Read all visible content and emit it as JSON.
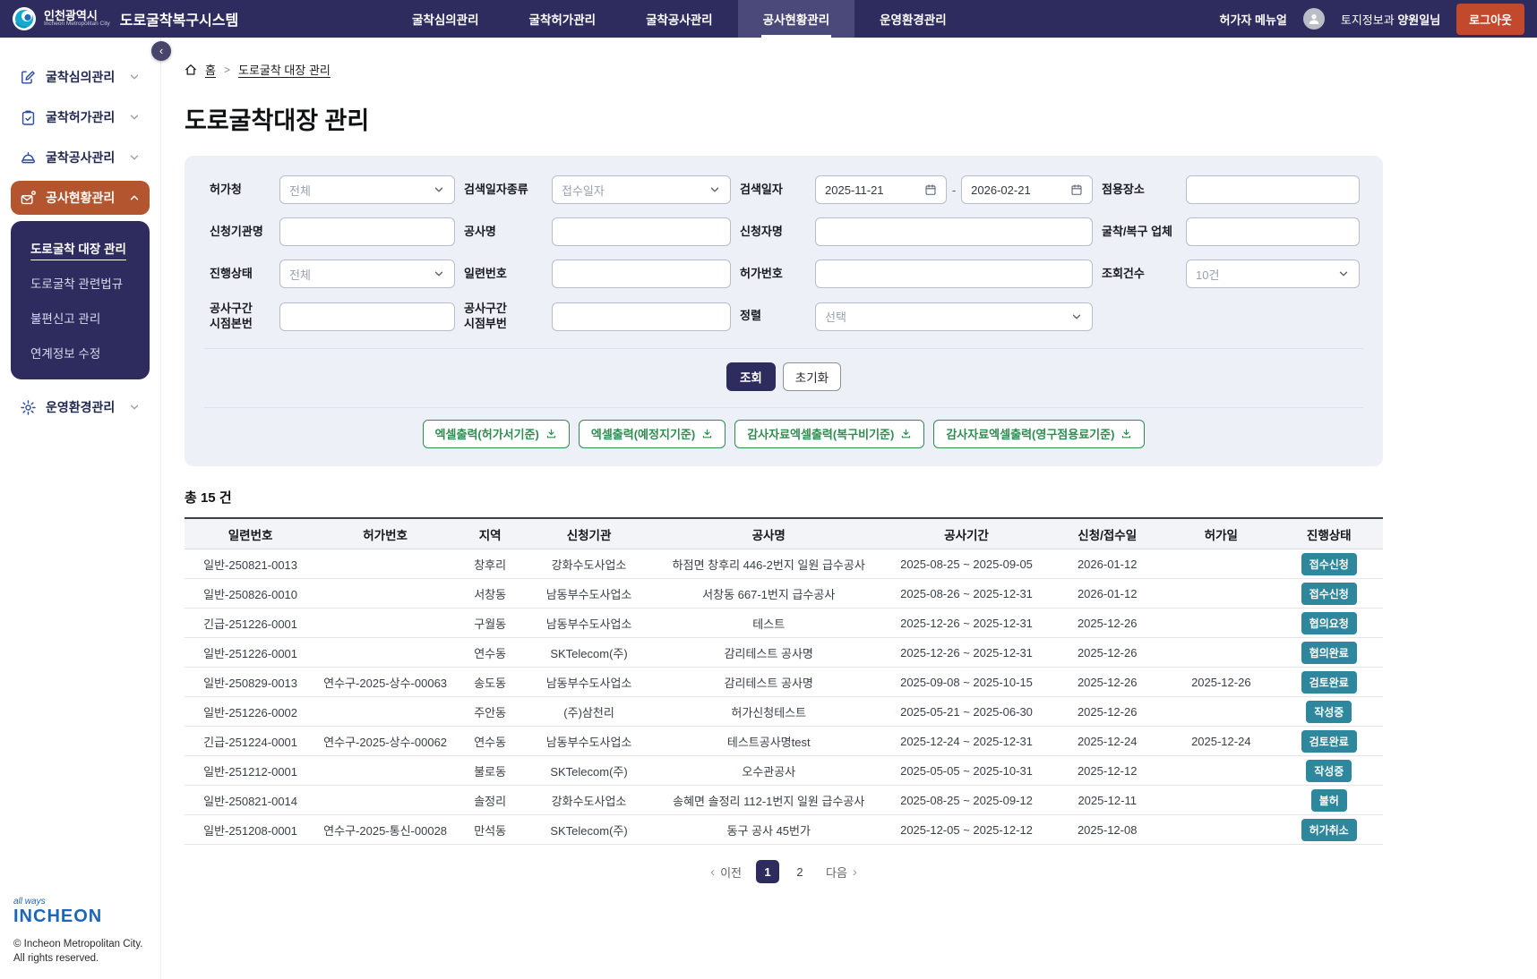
{
  "header": {
    "org": "인천광역시",
    "org_en": "Incheon Metropolitan City",
    "app_title": "도로굴착복구시스템",
    "nav": [
      {
        "label": "굴착심의관리"
      },
      {
        "label": "굴착허가관리"
      },
      {
        "label": "굴착공사관리"
      },
      {
        "label": "공사현황관리",
        "active": true
      },
      {
        "label": "운영환경관리"
      }
    ],
    "manual": "허가자 메뉴얼",
    "user_dept": "토지정보과",
    "user_name": "양원일님",
    "logout": "로그아웃"
  },
  "sidebar": {
    "items": [
      {
        "label": "굴착심의관리",
        "icon": "edit-document-icon"
      },
      {
        "label": "굴착허가관리",
        "icon": "clipboard-check-icon"
      },
      {
        "label": "굴착공사관리",
        "icon": "construction-icon"
      },
      {
        "label": "공사현황관리",
        "icon": "mail-person-icon",
        "active": true,
        "active_sub": 0,
        "submenu": [
          "도로굴착 대장 관리",
          "도로굴착 관련법규",
          "불편신고 관리",
          "연계정보 수정"
        ]
      },
      {
        "label": "운영환경관리",
        "icon": "gear-icon"
      }
    ]
  },
  "breadcrumb": {
    "home": "홈",
    "current": "도로굴착 대장 관리"
  },
  "page_title": "도로굴착대장 관리",
  "search": {
    "rows": [
      [
        {
          "label": "허가청",
          "name": "permit-office-select",
          "type": "select",
          "value": "전체"
        },
        {
          "label": "검색일자종류",
          "name": "search-date-type-select",
          "type": "select",
          "value": "접수일자"
        },
        {
          "label": "검색일자",
          "name": "search-date-range",
          "type": "daterange",
          "from": "2025-11-21",
          "to": "2026-02-21"
        },
        {
          "label": "점용장소",
          "name": "occupancy-place-input",
          "type": "input",
          "value": ""
        }
      ],
      [
        {
          "label": "신청기관명",
          "name": "applicant-org-input",
          "type": "input",
          "value": ""
        },
        {
          "label": "공사명",
          "name": "project-name-input",
          "type": "input",
          "value": ""
        },
        {
          "label": "신청자명",
          "name": "applicant-name-input",
          "type": "input",
          "value": ""
        },
        {
          "label": "굴착/복구 업체",
          "name": "contractor-input",
          "type": "input",
          "value": ""
        }
      ],
      [
        {
          "label": "진행상태",
          "name": "progress-status-select",
          "type": "select",
          "value": "전체"
        },
        {
          "label": "일련번호",
          "name": "serial-no-input",
          "type": "input",
          "value": ""
        },
        {
          "label": "허가번호",
          "name": "permit-no-input",
          "type": "input",
          "value": ""
        },
        {
          "label": "조회건수",
          "name": "result-count-select",
          "type": "select",
          "value": "10건"
        }
      ],
      [
        {
          "label": "공사구간\n시점본번",
          "name": "section-start-main-input",
          "type": "input",
          "value": ""
        },
        {
          "label": "공사구간\n시점부번",
          "name": "section-start-sub-input",
          "type": "input",
          "value": ""
        },
        {
          "label": "정렬",
          "name": "sort-select",
          "type": "select",
          "value": "선택"
        },
        {
          "label": "",
          "name": "empty-cell",
          "type": "none"
        }
      ]
    ],
    "actions": {
      "submit": "조회",
      "reset": "초기화"
    },
    "excel_buttons": [
      "엑셀출력(허가서기준)",
      "엑셀출력(예정지기준)",
      "감사자료엑셀출력(복구비기준)",
      "감사자료엑셀출력(영구점용료기준)"
    ]
  },
  "table": {
    "total": "총 15 건",
    "headers": [
      "일련번호",
      "허가번호",
      "지역",
      "신청기관",
      "공사명",
      "공사기간",
      "신청/접수일",
      "허가일",
      "진행상태"
    ],
    "header_keys": [
      "serial",
      "permit-no",
      "region",
      "applicant",
      "project",
      "period",
      "received",
      "permitted",
      "status"
    ],
    "rows": [
      [
        "일반-250821-0013",
        "",
        "창후리",
        "강화수도사업소",
        "하점면 창후리 446-2번지 일원 급수공사",
        "2025-08-25 ~ 2025-09-05",
        "2026-01-12",
        "",
        "접수신청"
      ],
      [
        "일반-250826-0010",
        "",
        "서창동",
        "남동부수도사업소",
        "서창동 667-1번지 급수공사",
        "2025-08-26 ~ 2025-12-31",
        "2026-01-12",
        "",
        "접수신청"
      ],
      [
        "긴급-251226-0001",
        "",
        "구월동",
        "남동부수도사업소",
        "테스트",
        "2025-12-26 ~ 2025-12-31",
        "2025-12-26",
        "",
        "협의요청"
      ],
      [
        "일반-251226-0001",
        "",
        "연수동",
        "SKTelecom(주)",
        "감리테스트 공사명",
        "2025-12-26 ~ 2025-12-31",
        "2025-12-26",
        "",
        "협의완료"
      ],
      [
        "일반-250829-0013",
        "연수구-2025-상수-00063",
        "송도동",
        "남동부수도사업소",
        "감리테스트 공사명",
        "2025-09-08 ~ 2025-10-15",
        "2025-12-26",
        "2025-12-26",
        "검토완료"
      ],
      [
        "일반-251226-0002",
        "",
        "주안동",
        "(주)삼천리",
        "허가신청테스트",
        "2025-05-21 ~ 2025-06-30",
        "2025-12-26",
        "",
        "작성중"
      ],
      [
        "긴급-251224-0001",
        "연수구-2025-상수-00062",
        "연수동",
        "남동부수도사업소",
        "테스트공사명test",
        "2025-12-24 ~ 2025-12-31",
        "2025-12-24",
        "2025-12-24",
        "검토완료"
      ],
      [
        "일반-251212-0001",
        "",
        "불로동",
        "SKTelecom(주)",
        "오수관공사",
        "2025-05-05 ~ 2025-10-31",
        "2025-12-12",
        "",
        "작성중"
      ],
      [
        "일반-250821-0014",
        "",
        "솔정리",
        "강화수도사업소",
        "송혜면 솔정리 112-1번지 일원 급수공사",
        "2025-08-25 ~ 2025-09-12",
        "2025-12-11",
        "",
        "불허"
      ],
      [
        "일반-251208-0001",
        "연수구-2025-통신-00028",
        "만석동",
        "SKTelecom(주)",
        "동구 공사 45번가",
        "2025-12-05 ~ 2025-12-12",
        "2025-12-08",
        "",
        "허가취소"
      ]
    ]
  },
  "pagination": {
    "prev": "이전",
    "pages": [
      "1",
      "2"
    ],
    "active": "1",
    "next": "다음"
  },
  "footer": {
    "brand_small": "all ways",
    "brand": "INCHEON",
    "copyright": "© Incheon Metropolitan City.",
    "rights": "All rights reserved."
  },
  "colors": {
    "navbar_navy": "#2E2C5F",
    "active_tab": "#4B4979",
    "sidebar_active_orange": "#B3552F",
    "logout_red": "#C2492C",
    "panel_bg": "#EDF0F7",
    "badge_teal": "#2E879C",
    "excel_green": "#2F8C51"
  }
}
